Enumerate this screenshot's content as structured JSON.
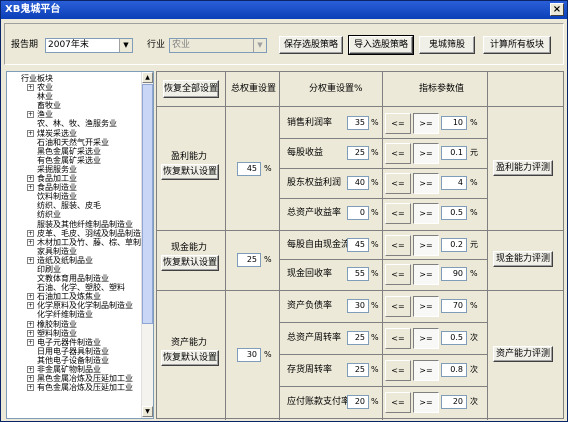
{
  "window": {
    "title": "XB鬼城平台",
    "close_glyph": "×"
  },
  "toolbar": {
    "report_label": "报告期",
    "report_value": "2007年末",
    "industry_label": "行业",
    "industry_value": "农业",
    "save_strategy": "保存选股策略",
    "import_strategy": "导入选股策略",
    "ghost_filter": "鬼城筛股",
    "calc_all": "计算所有板块"
  },
  "tree": {
    "root": "行业板块",
    "items": [
      {
        "label": "农业",
        "exp": "+"
      },
      {
        "label": "林业",
        "exp": ""
      },
      {
        "label": "畜牧业",
        "exp": ""
      },
      {
        "label": "渔业",
        "exp": "+"
      },
      {
        "label": "农、林、牧、渔服务业",
        "exp": ""
      },
      {
        "label": "煤炭采选业",
        "exp": "+"
      },
      {
        "label": "石油和天然气开采业",
        "exp": ""
      },
      {
        "label": "黑色金属矿采选业",
        "exp": ""
      },
      {
        "label": "有色金属矿采选业",
        "exp": ""
      },
      {
        "label": "采掘服务业",
        "exp": ""
      },
      {
        "label": "食品加工业",
        "exp": "+"
      },
      {
        "label": "食品制造业",
        "exp": "+"
      },
      {
        "label": "饮料制造业",
        "exp": ""
      },
      {
        "label": "纺织、服装、皮毛",
        "exp": ""
      },
      {
        "label": "纺织业",
        "exp": ""
      },
      {
        "label": "服装及其他纤维制品制造业",
        "exp": ""
      },
      {
        "label": "皮革、毛皮、羽绒及制品制造业",
        "exp": "+"
      },
      {
        "label": "木材加工及竹、藤、棕、草制品业",
        "exp": "+"
      },
      {
        "label": "家具制造业",
        "exp": ""
      },
      {
        "label": "造纸及纸制品业",
        "exp": "+"
      },
      {
        "label": "印刷业",
        "exp": ""
      },
      {
        "label": "文教体育用品制造业",
        "exp": ""
      },
      {
        "label": "石油、化学、塑胶、塑料",
        "exp": ""
      },
      {
        "label": "石油加工及炼焦业",
        "exp": "+"
      },
      {
        "label": "化学原料及化学制品制造业",
        "exp": "+"
      },
      {
        "label": "化学纤维制造业",
        "exp": ""
      },
      {
        "label": "橡胶制造业",
        "exp": "+"
      },
      {
        "label": "塑料制造业",
        "exp": "+"
      },
      {
        "label": "电子元器件制造业",
        "exp": "+"
      },
      {
        "label": "日用电子器具制造业",
        "exp": ""
      },
      {
        "label": "其他电子设备制造业",
        "exp": ""
      },
      {
        "label": "非金属矿物制品业",
        "exp": "+"
      },
      {
        "label": "黑色金属冶炼及压延加工业",
        "exp": "+"
      },
      {
        "label": "有色金属冶炼及压延加工业",
        "exp": "+"
      }
    ]
  },
  "panel": {
    "restore_all": "恢复全部设置",
    "total_weight_header": "总权重设置",
    "sub_weight_header": "分权重设置%",
    "indicator_header": "指标参数值",
    "restore_default": "恢复默认设置",
    "pct": "%",
    "groups": [
      {
        "name": "盈利能力",
        "total": "45",
        "eval": "盈利能力评测",
        "rows": [
          {
            "name": "销售利润率",
            "weight": "35",
            "op1": "<=",
            "op2": ">=",
            "value": "10",
            "unit": "%"
          },
          {
            "name": "每股收益",
            "weight": "25",
            "op1": "<=",
            "op2": ">=",
            "value": "0.1",
            "unit": "元"
          },
          {
            "name": "股东权益利润",
            "weight": "40",
            "op1": "<=",
            "op2": ">=",
            "value": "4",
            "unit": "%"
          },
          {
            "name": "总资产收益率",
            "weight": "0",
            "op1": "<=",
            "op2": ">=",
            "value": "0.5",
            "unit": "%"
          }
        ]
      },
      {
        "name": "现金能力",
        "total": "25",
        "eval": "现金能力评测",
        "rows": [
          {
            "name": "每股自由现金流",
            "weight": "45",
            "op1": "<=",
            "op2": ">=",
            "value": "0.2",
            "unit": "元"
          },
          {
            "name": "现金回收率",
            "weight": "55",
            "op1": "<=",
            "op2": ">=",
            "value": "90",
            "unit": "%"
          }
        ]
      },
      {
        "name": "资产能力",
        "total": "30",
        "eval": "资产能力评测",
        "rows": [
          {
            "name": "资产负债率",
            "weight": "30",
            "op1": "<=",
            "op2": ">=",
            "value": "70",
            "unit": "%"
          },
          {
            "name": "总资产周转率",
            "weight": "25",
            "op1": "<=",
            "op2": ">=",
            "value": "0.5",
            "unit": "次"
          },
          {
            "name": "存货周转率",
            "weight": "25",
            "op1": "<=",
            "op2": ">=",
            "value": "0.8",
            "unit": "次"
          },
          {
            "name": "应付账款支付率",
            "weight": "20",
            "op1": "<=",
            "op2": ">=",
            "value": "20",
            "unit": "次"
          }
        ]
      }
    ]
  }
}
